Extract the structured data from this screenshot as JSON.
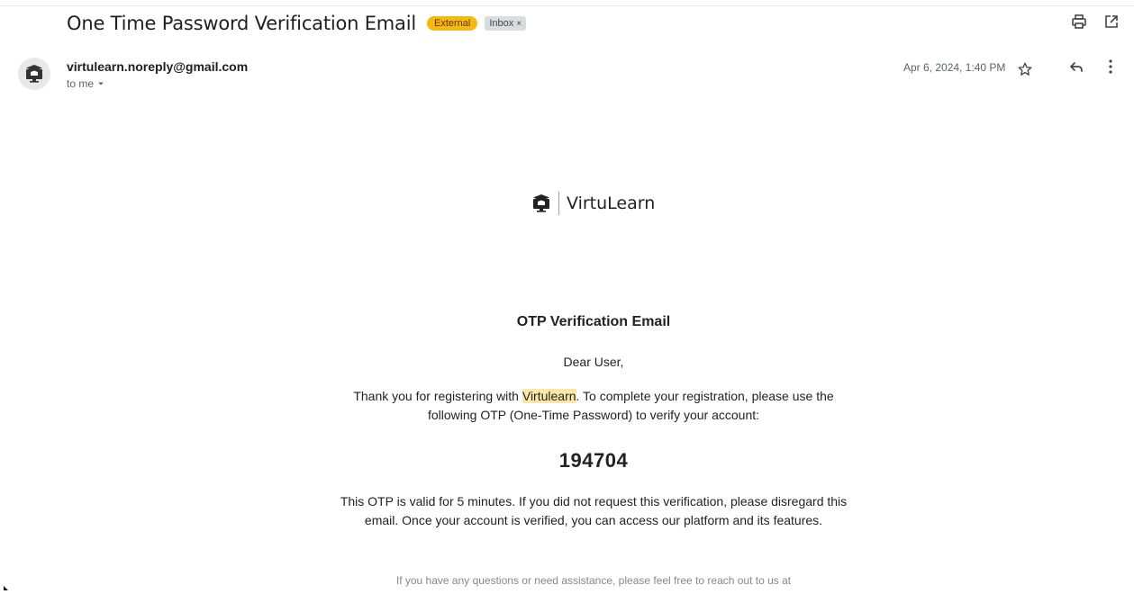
{
  "header": {
    "subject": "One Time Password Verification Email",
    "label_external": "External",
    "label_inbox": "Inbox",
    "label_inbox_remove": "×"
  },
  "sender": {
    "email": "virtulearn.noreply@gmail.com",
    "recipient": "to me",
    "date": "Apr 6, 2024, 1:40 PM"
  },
  "icons": {
    "print": "print-icon",
    "open_new": "open-in-new-window-icon",
    "star": "star-icon",
    "reply": "reply-icon",
    "more": "more-vert-icon",
    "avatar": "monitor-graduation-cap-icon",
    "brand_logo": "monitor-graduation-cap-icon"
  },
  "email": {
    "brand_name": "VirtuLearn",
    "title": "OTP Verification Email",
    "greeting": "Dear User,",
    "para1_pre": "Thank you for registering with ",
    "para1_highlight": "Virtulearn",
    "para1_post": ". To complete your registration, please use the following OTP (One-Time Password) to verify your account:",
    "otp": "194704",
    "para2": "This OTP is valid for 5 minutes. If you did not request this verification, please disregard this email. Once your account is verified, you can access our platform and its features.",
    "para3": "If you have any questions or need assistance, please feel free to reach out to us at"
  },
  "colors": {
    "external_badge": "#f6b812",
    "highlight": "#fce8a6"
  }
}
